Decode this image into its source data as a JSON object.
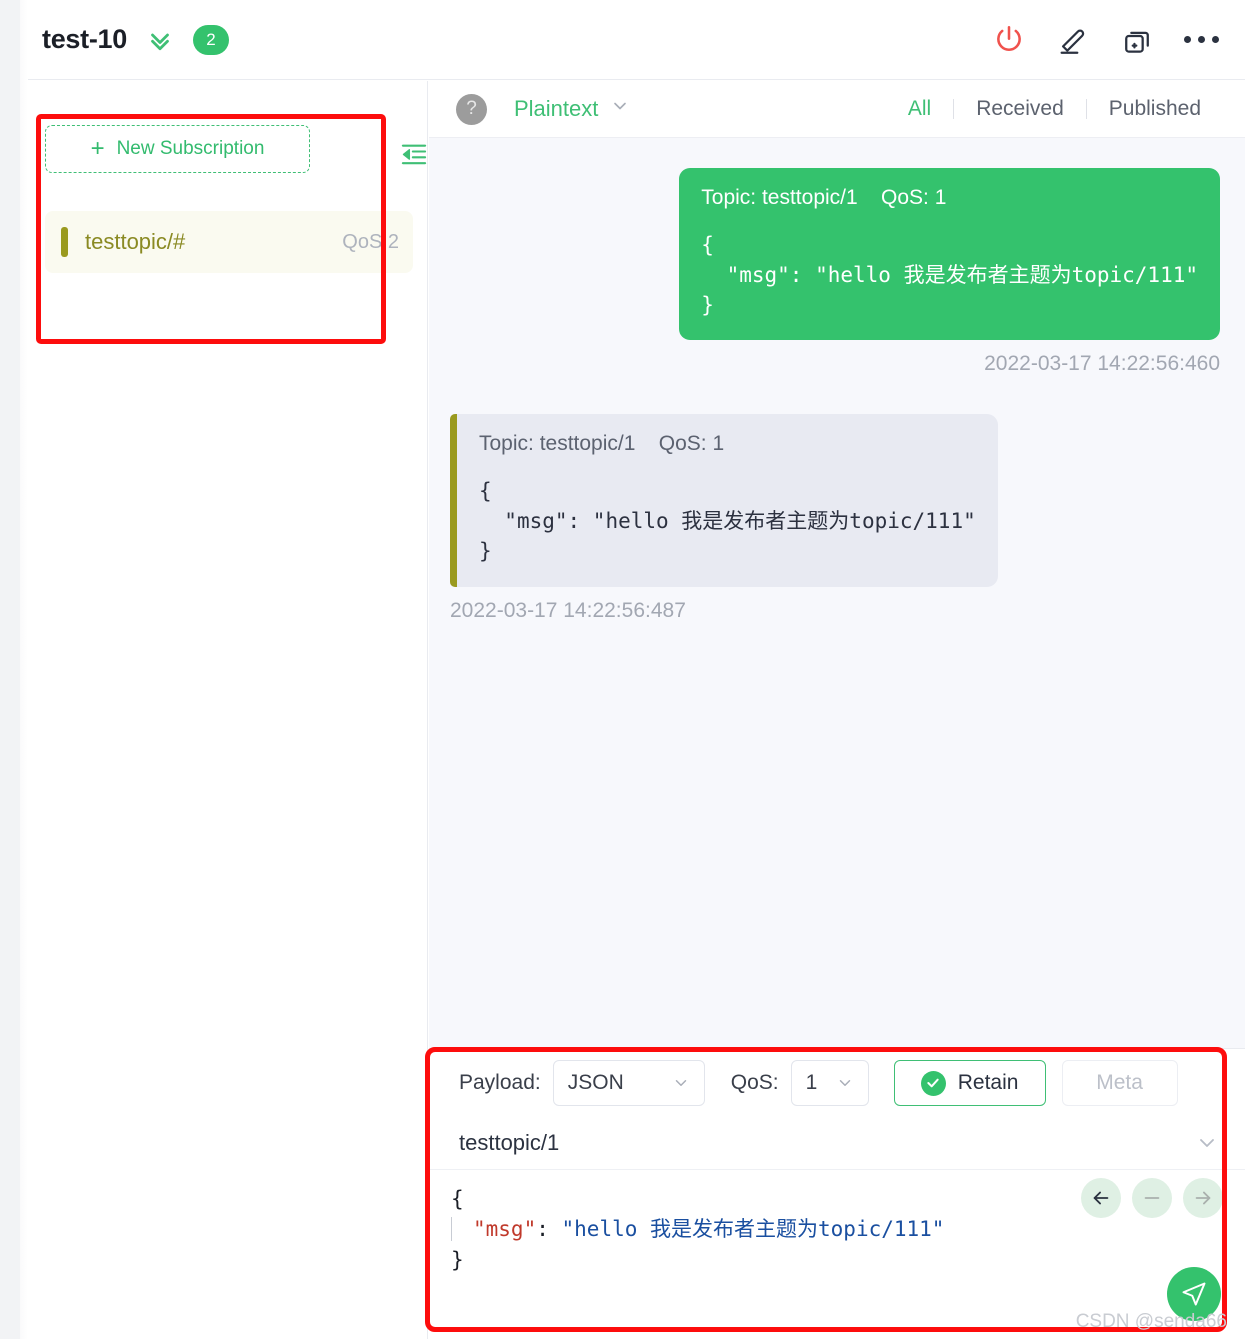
{
  "header": {
    "connection_name": "test-10",
    "chevrons_icon": "chevrons-down-icon",
    "message_count": "2",
    "power_icon": "power-icon",
    "edit_icon": "pencil-edit-icon",
    "duplicate_icon": "duplicate-add-icon",
    "more_icon": "more-dots-icon"
  },
  "sidebar": {
    "new_subscription_label": "New Subscription",
    "plus_icon": "plus-icon",
    "collapse_icon": "collapse-left-icon",
    "subscriptions": [
      {
        "topic": "testtopic/#",
        "qos": "QoS 2",
        "color": "#9a9a1f"
      }
    ]
  },
  "messages_panel": {
    "help_icon": "question-circle-icon",
    "format": "Plaintext",
    "format_chevron_icon": "chevron-down-icon",
    "tabs": [
      {
        "label": "All",
        "active": true
      },
      {
        "label": "Received",
        "active": false
      },
      {
        "label": "Published",
        "active": false
      }
    ],
    "messages": [
      {
        "direction": "sent",
        "head": "Topic: testtopic/1    QoS: 1",
        "body": "{\n  \"msg\": \"hello 我是发布者主题为topic/111\"\n}",
        "time": "2022-03-17 14:22:56:460"
      },
      {
        "direction": "received",
        "head": "Topic: testtopic/1    QoS: 1",
        "body": "{\n  \"msg\": \"hello 我是发布者主题为topic/111\"\n}",
        "time": "2022-03-17 14:22:56:487"
      }
    ]
  },
  "publish_panel": {
    "payload_label": "Payload:",
    "payload_value": "JSON",
    "qos_label": "QoS:",
    "qos_value": "1",
    "retain_label": "Retain",
    "retain_checked": true,
    "check_icon": "check-circle-icon",
    "meta_label": "Meta",
    "meta_enabled": false,
    "topic_value": "testtopic/1",
    "topic_chevron_icon": "chevron-down-icon",
    "editor": {
      "line_open": "{",
      "key": "\"msg\"",
      "colon": ": ",
      "value": "\"hello 我是发布者主题为topic/111\"",
      "line_close": "}"
    },
    "editor_buttons": [
      {
        "icon": "arrow-left-icon",
        "enabled": true
      },
      {
        "icon": "minus-icon",
        "enabled": false
      },
      {
        "icon": "arrow-right-icon",
        "enabled": false
      }
    ],
    "send_icon": "send-plane-icon"
  },
  "watermark": "CSDN @senda66",
  "colors": {
    "brand_green": "#34c26d",
    "annotation_red": "#fd0d0d",
    "subscription_olive": "#9a9a1f",
    "power_red": "#f0524d"
  }
}
